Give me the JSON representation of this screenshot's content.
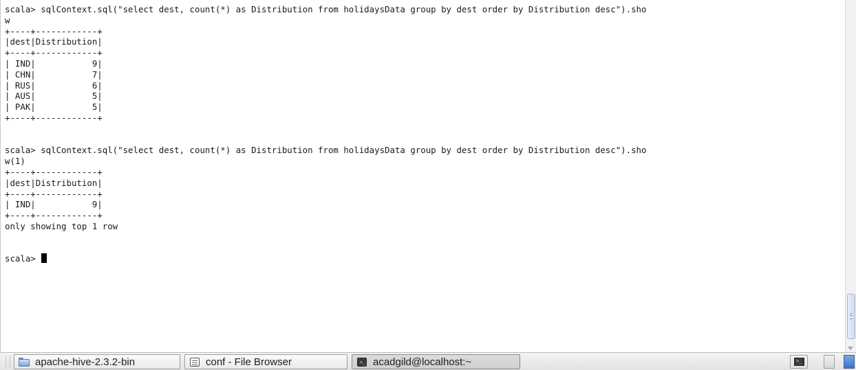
{
  "terminal": {
    "lines": [
      "scala> sqlContext.sql(\"select dest, count(*) as Distribution from holidaysData group by dest order by Distribution desc\").sho",
      "w",
      "+----+------------+",
      "|dest|Distribution|",
      "+----+------------+",
      "| IND|           9|",
      "| CHN|           7|",
      "| RUS|           6|",
      "| AUS|           5|",
      "| PAK|           5|",
      "+----+------------+",
      "",
      "",
      "scala> sqlContext.sql(\"select dest, count(*) as Distribution from holidaysData group by dest order by Distribution desc\").sho",
      "w(1)",
      "+----+------------+",
      "|dest|Distribution|",
      "+----+------------+",
      "| IND|           9|",
      "+----+------------+",
      "only showing top 1 row",
      "",
      ""
    ],
    "prompt": "scala> "
  },
  "taskbar": {
    "items": [
      {
        "label": "apache-hive-2.3.2-bin",
        "icon": "folder-icon"
      },
      {
        "label": "conf - File Browser",
        "icon": "file-browser-icon"
      },
      {
        "label": "acadgild@localhost:~",
        "icon": "terminal-icon"
      }
    ]
  }
}
